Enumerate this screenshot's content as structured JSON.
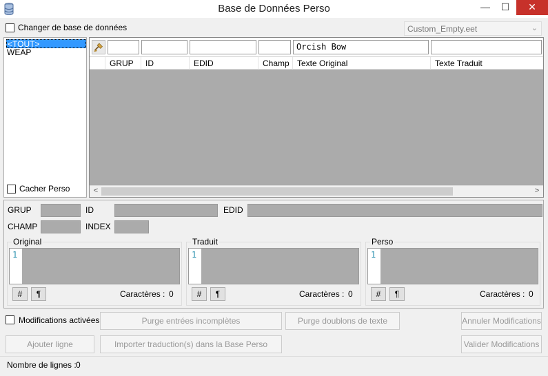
{
  "window": {
    "title": "Base de Données Perso",
    "minimize_glyph": "—",
    "maximize_glyph": "☐",
    "close_glyph": "✕"
  },
  "top": {
    "change_db_label": "Changer de base de données",
    "db_combo_value": "Custom_Empty.eet",
    "combo_arrow": "⌄"
  },
  "left_list": {
    "items": [
      "<TOUT>",
      "WEAP"
    ],
    "selected_index": 0,
    "hide_perso_label": "Cacher Perso"
  },
  "grid": {
    "filters": [
      "",
      "",
      "",
      "",
      "Orcish Bow",
      ""
    ],
    "columns": [
      "GRUP",
      "ID",
      "EDID",
      "Champ",
      "Texte Original",
      "Texte Traduit"
    ],
    "scroll_left": "<",
    "scroll_right": ">"
  },
  "detail": {
    "grup_label": "GRUP",
    "id_label": "ID",
    "edid_label": "EDID",
    "champ_label": "CHAMP",
    "index_label": "INDEX",
    "groups": [
      {
        "title": "Original",
        "line_no": "1",
        "hash_btn": "#",
        "pilcrow_btn": "¶",
        "chars_label": "Caractères :",
        "chars_value": "0"
      },
      {
        "title": "Traduit",
        "line_no": "1",
        "hash_btn": "#",
        "pilcrow_btn": "¶",
        "chars_label": "Caractères :",
        "chars_value": "0"
      },
      {
        "title": "Perso",
        "line_no": "1",
        "hash_btn": "#",
        "pilcrow_btn": "¶",
        "chars_label": "Caractères :",
        "chars_value": "0"
      }
    ]
  },
  "actions": {
    "modifications_label": "Modifications activées",
    "purge_incomplete": "Purge entrées incomplètes",
    "purge_duplicates": "Purge doublons de texte",
    "cancel_mods": "Annuler Modifications",
    "add_line": "Ajouter ligne",
    "import_translation": "Importer traduction(s) dans la Base Perso",
    "validate_mods": "Valider Modifications"
  },
  "status": {
    "lines_label": "Nombre de lignes :",
    "lines_value": "0"
  }
}
